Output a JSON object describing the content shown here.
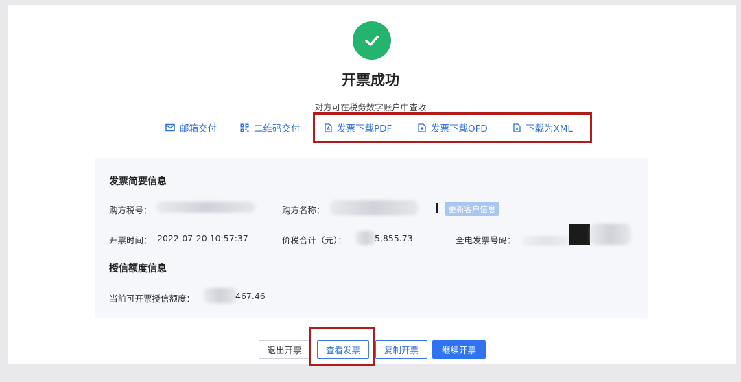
{
  "header": {
    "title": "开票成功",
    "subtitle": "对方可在税务数字账户中查收"
  },
  "actions": [
    {
      "label": "邮箱交付",
      "icon": "mail-icon"
    },
    {
      "label": "二维码交付",
      "icon": "qrcode-icon"
    },
    {
      "label": "发票下载PDF",
      "icon": "pdf-file-icon"
    },
    {
      "label": "发票下载OFD",
      "icon": "ofd-file-icon"
    },
    {
      "label": "下载为XML",
      "icon": "xml-file-icon"
    }
  ],
  "summary": {
    "title": "发票简要信息",
    "buyer_tax_label": "购方税号：",
    "buyer_name_label": "购方名称：",
    "update_customer_label": "更新客户信息",
    "issue_time_label": "开票时间：",
    "issue_time_value": "2022-07-20 10:57:37",
    "total_label": "价税合计（元）：",
    "total_value": "5,855.73",
    "invoice_no_label": "全电发票号码："
  },
  "credit": {
    "title": "授信额度信息",
    "available_label": "当前可开票授信额度：",
    "available_value": "467.46"
  },
  "buttons": {
    "exit": "退出开票",
    "view": "查看发票",
    "copy": "复制开票",
    "continue": "继续开票"
  },
  "colors": {
    "success": "#24b46e",
    "link": "#2f6fe0",
    "primary": "#2f73f0",
    "highlight": "#b31b1b",
    "panel": "#f5f7fb"
  }
}
